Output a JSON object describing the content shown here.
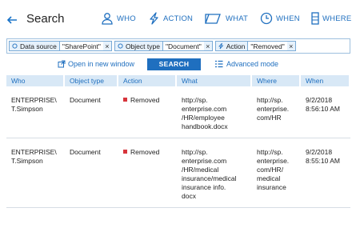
{
  "header": {
    "title": "Search",
    "nav": [
      {
        "label": "WHO",
        "icon": "person-icon"
      },
      {
        "label": "ACTION",
        "icon": "lightning-icon"
      },
      {
        "label": "WHAT",
        "icon": "folder-icon"
      },
      {
        "label": "WHEN",
        "icon": "clock-icon"
      },
      {
        "label": "WHERE",
        "icon": "server-icon"
      }
    ]
  },
  "filters": [
    {
      "field": "Data source",
      "value": "\"SharePoint\"",
      "icon": "filter-circle-icon"
    },
    {
      "field": "Object type",
      "value": "\"Document\"",
      "icon": "filter-circle-icon"
    },
    {
      "field": "Action",
      "value": "\"Removed\"",
      "icon": "lightning-icon"
    }
  ],
  "actions": {
    "open_new_window": "Open in new window",
    "search": "SEARCH",
    "advanced_mode": "Advanced mode"
  },
  "table": {
    "columns": [
      "Who",
      "Object type",
      "Action",
      "What",
      "Where",
      "When"
    ],
    "rows": [
      {
        "who": "ENTERPRISE\\\nT.Simpson",
        "object_type": "Document",
        "action": "Removed",
        "what": "http://sp.\nenterprise.com\n/HR/employee\nhandbook.docx",
        "where": "http://sp.\nenterprise.\ncom/HR",
        "when": "9/2/2018\n8:56:10 AM"
      },
      {
        "who": "ENTERPRISE\\\nT.Simpson",
        "object_type": "Document",
        "action": "Removed",
        "what": "http://sp.\nenterprise.com\n/HR/medical\ninsurance/medical\ninsurance info.\ndocx",
        "where": "http://sp.\nenterprise.\ncom/HR/\nmedical\ninsurance",
        "when": "9/2/2018\n8:55:10 AM"
      }
    ]
  },
  "colors": {
    "accent": "#1f6fbf",
    "header_bg": "#d8e8f6",
    "removed": "#d7343b"
  }
}
